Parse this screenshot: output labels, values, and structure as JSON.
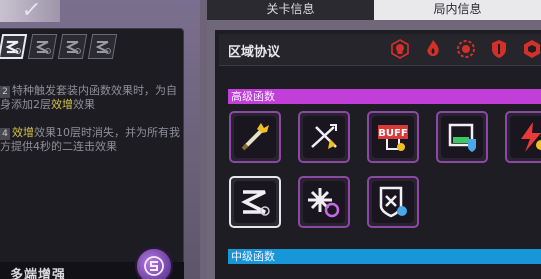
{
  "tabs": {
    "stage_info": "关卡信息",
    "run_info": "局内信息"
  },
  "zone": {
    "title": "区域协议",
    "icons": [
      "red-skull-icon",
      "red-flame-icon",
      "red-gear-icon",
      "red-shield-icon",
      "red-hex-icon"
    ]
  },
  "left": {
    "effects": [
      "gear-s-icon",
      "gear-s-icon",
      "gear-s-icon",
      "gear-s-icon"
    ],
    "desc1": {
      "num": "2",
      "pre": "特种触发套装内函数效果时，为自身添加2层",
      "hl": "效增",
      "post": "效果"
    },
    "desc2": {
      "num": "4",
      "hl": "效增",
      "post": "效果10层时消失，并为所有我方提供4秒的二连击效果"
    },
    "bottom_title": "多端增强"
  },
  "sections": {
    "advanced": "高级函数",
    "intermediate": "中级函数"
  },
  "cards": [
    {
      "icon": "golden-sword-icon"
    },
    {
      "icon": "crossed-arrows-icon"
    },
    {
      "icon": "buff-sign-icon",
      "text": "BUFF"
    },
    {
      "icon": "shield-screen-icon"
    },
    {
      "icon": "red-lightning-icon"
    },
    {
      "icon": "gear-s-icon"
    },
    {
      "icon": "starburst-icon"
    },
    {
      "icon": "x-shield-icon"
    }
  ],
  "colors": {
    "advanced": "#c23ed8",
    "intermediate": "#1797d8",
    "highlight": "#d6c34a",
    "card_border": "#8a4aa4"
  }
}
